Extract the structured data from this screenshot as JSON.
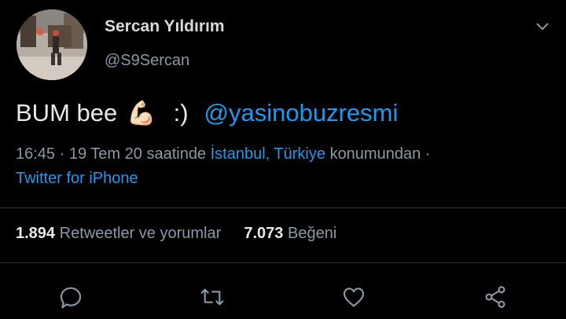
{
  "user": {
    "name": "Sercan Yıldırım",
    "handle": "@S9Sercan"
  },
  "tweet": {
    "text_part": "BUM bee",
    "emoji": "💪🏻",
    "smile": ":)",
    "mention": "@yasinobuzresmi"
  },
  "meta": {
    "time": "16:45",
    "sep1": "·",
    "date_text": "19 Tem 20 saatinde",
    "location": "İstanbul, Türkiye",
    "location_suffix": "konumundan",
    "sep2": "·",
    "source": "Twitter for iPhone"
  },
  "stats": {
    "retweets_count": "1.894",
    "retweets_label": "Retweetler ve yorumlar",
    "likes_count": "7.073",
    "likes_label": "Beğeni"
  },
  "icons": {
    "reply": "reply-icon",
    "retweet": "retweet-icon",
    "like": "heart-icon",
    "share": "share-icon",
    "menu": "chevron-down-icon"
  },
  "colors": {
    "background": "#000000",
    "link": "#1d9bf0",
    "secondary_text": "#8b98a5"
  }
}
